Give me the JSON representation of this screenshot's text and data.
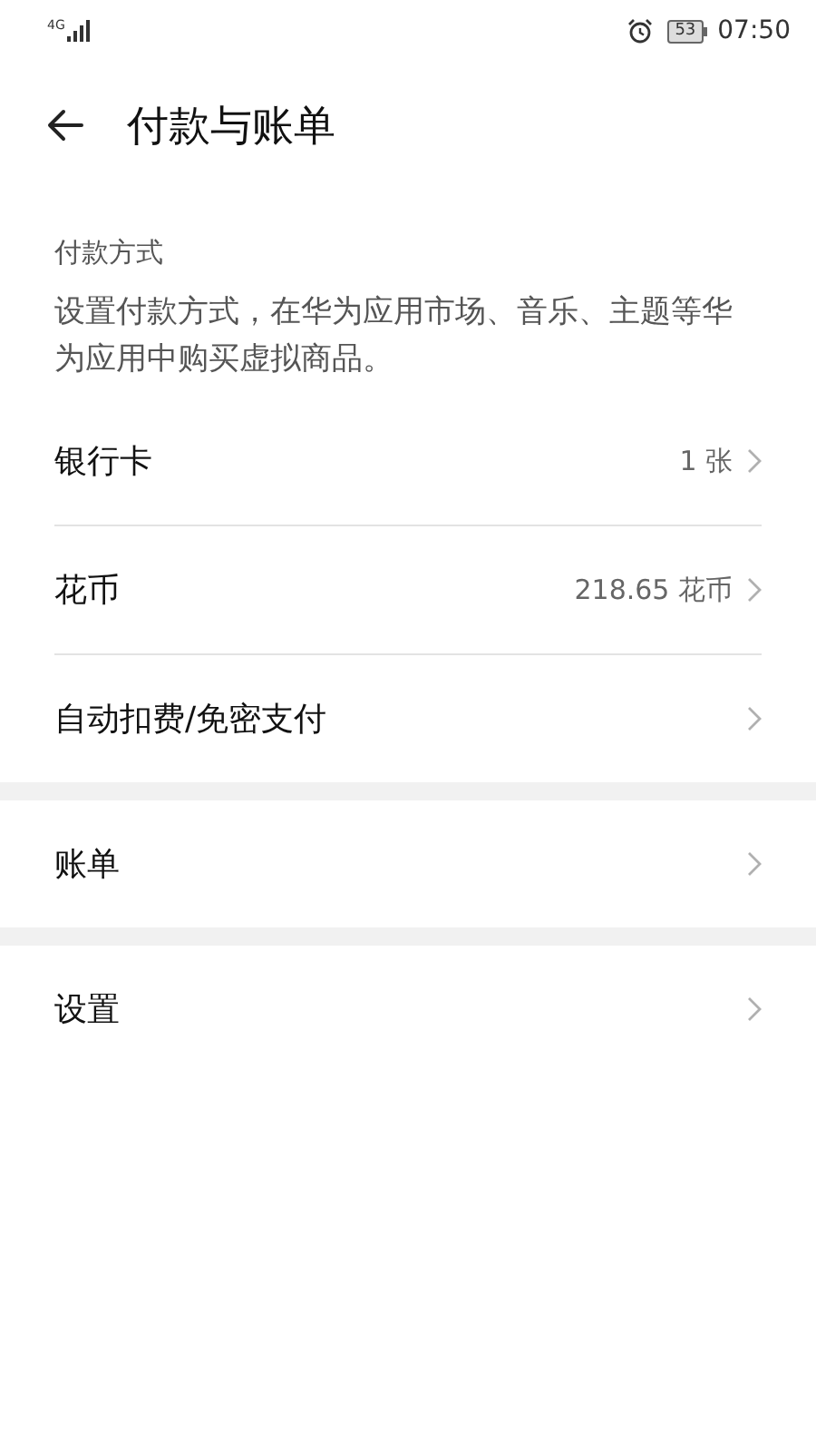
{
  "status_bar": {
    "network": "4G",
    "battery": "53",
    "time": "07:50"
  },
  "header": {
    "title": "付款与账单"
  },
  "groups": [
    {
      "label": "付款方式",
      "description": "设置付款方式，在华为应用市场、音乐、主题等华为应用中购买虚拟商品。",
      "rows": [
        {
          "label": "银行卡",
          "value": "1 张"
        },
        {
          "label": "花币",
          "value": "218.65 花币"
        },
        {
          "label": "自动扣费/免密支付"
        }
      ]
    },
    {
      "rows": [
        {
          "label": "账单"
        }
      ]
    },
    {
      "rows": [
        {
          "label": "设置"
        }
      ]
    }
  ]
}
